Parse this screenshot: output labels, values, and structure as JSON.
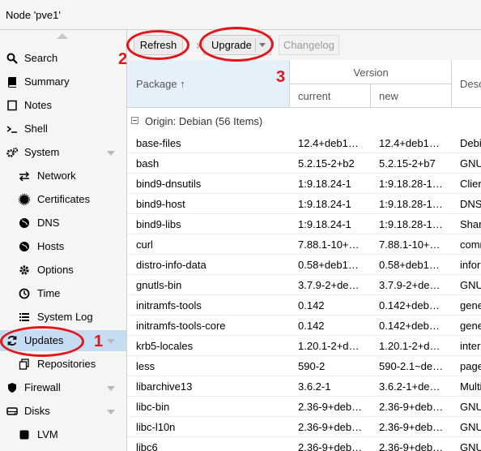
{
  "title": "Node 'pve1'",
  "sidebar": {
    "items": [
      {
        "label": "Search",
        "icon": "search-icon",
        "level": 0
      },
      {
        "label": "Summary",
        "icon": "book-icon",
        "level": 0
      },
      {
        "label": "Notes",
        "icon": "notes-icon",
        "level": 0
      },
      {
        "label": "Shell",
        "icon": "terminal-icon",
        "level": 0
      },
      {
        "label": "System",
        "icon": "gears-icon",
        "level": 0,
        "expandable": true
      },
      {
        "label": "Network",
        "icon": "exchange-icon",
        "level": 1
      },
      {
        "label": "Certificates",
        "icon": "certificate-icon",
        "level": 1
      },
      {
        "label": "DNS",
        "icon": "globe-icon",
        "level": 1
      },
      {
        "label": "Hosts",
        "icon": "globe-icon",
        "level": 1
      },
      {
        "label": "Options",
        "icon": "gear-icon",
        "level": 1
      },
      {
        "label": "Time",
        "icon": "clock-icon",
        "level": 1
      },
      {
        "label": "System Log",
        "icon": "list-icon",
        "level": 1
      },
      {
        "label": "Updates",
        "icon": "refresh-icon",
        "level": 0,
        "selected": true,
        "expandable": true
      },
      {
        "label": "Repositories",
        "icon": "files-icon",
        "level": 1
      },
      {
        "label": "Firewall",
        "icon": "shield-icon",
        "level": 0,
        "expandable": true
      },
      {
        "label": "Disks",
        "icon": "hdd-icon",
        "level": 0,
        "expandable": true
      },
      {
        "label": "LVM",
        "icon": "square-icon",
        "level": 1
      }
    ]
  },
  "toolbar": {
    "refresh_label": "Refresh",
    "upgrade_label": "Upgrade",
    "changelog_label": "Changelog"
  },
  "grid": {
    "col_package": "Package ↑",
    "col_version": "Version",
    "col_current": "current",
    "col_new": "new",
    "col_description": "Desc",
    "group_label": "Origin: Debian (56 Items)",
    "rows": [
      {
        "package": "base-files",
        "current": "12.4+deb1…",
        "new": "12.4+deb1…",
        "description": "Debi"
      },
      {
        "package": "bash",
        "current": "5.2.15-2+b2",
        "new": "5.2.15-2+b7",
        "description": "GNU"
      },
      {
        "package": "bind9-dnsutils",
        "current": "1:9.18.24-1",
        "new": "1:9.18.28-1…",
        "description": "Clier"
      },
      {
        "package": "bind9-host",
        "current": "1:9.18.24-1",
        "new": "1:9.18.28-1…",
        "description": "DNS"
      },
      {
        "package": "bind9-libs",
        "current": "1:9.18.24-1",
        "new": "1:9.18.28-1…",
        "description": "Shar"
      },
      {
        "package": "curl",
        "current": "7.88.1-10+…",
        "new": "7.88.1-10+…",
        "description": "comr"
      },
      {
        "package": "distro-info-data",
        "current": "0.58+deb1…",
        "new": "0.58+deb1…",
        "description": "infor"
      },
      {
        "package": "gnutls-bin",
        "current": "3.7.9-2+de…",
        "new": "3.7.9-2+de…",
        "description": "GNU"
      },
      {
        "package": "initramfs-tools",
        "current": "0.142",
        "new": "0.142+deb…",
        "description": "gene"
      },
      {
        "package": "initramfs-tools-core",
        "current": "0.142",
        "new": "0.142+deb…",
        "description": "gene"
      },
      {
        "package": "krb5-locales",
        "current": "1.20.1-2+d…",
        "new": "1.20.1-2+d…",
        "description": "inter"
      },
      {
        "package": "less",
        "current": "590-2",
        "new": "590-2.1~de…",
        "description": "page"
      },
      {
        "package": "libarchive13",
        "current": "3.6.2-1",
        "new": "3.6.2-1+de…",
        "description": "Multi"
      },
      {
        "package": "libc-bin",
        "current": "2.36-9+deb…",
        "new": "2.36-9+deb…",
        "description": "GNU"
      },
      {
        "package": "libc-l10n",
        "current": "2.36-9+deb…",
        "new": "2.36-9+deb…",
        "description": "GNU"
      },
      {
        "package": "libc6",
        "current": "2.36-9+deb…",
        "new": "2.36-9+deb…",
        "description": "GNU"
      }
    ]
  },
  "annotations": {
    "num1": "1",
    "num2": "2",
    "num3": "3",
    "color": "#e0161b"
  },
  "colors": {
    "selected_bg": "#c6dcf2",
    "sorted_header_bg": "#e6f0fa"
  }
}
